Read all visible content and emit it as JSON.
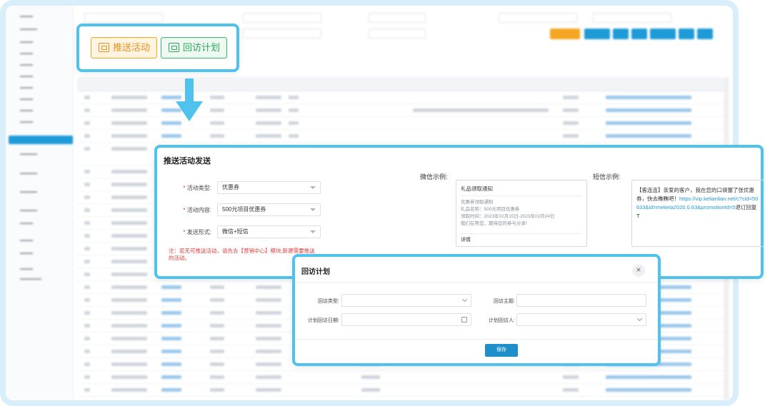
{
  "buttons": {
    "push_activity": "推送活动",
    "visit_plan": "回访计划"
  },
  "push_panel": {
    "title": "推送活动发送",
    "activity_type_label": "活动类型:",
    "activity_type_value": "优惠券",
    "activity_content_label": "活动内容:",
    "activity_content_value": "500元项目优惠券",
    "send_form_label": "发送形式:",
    "send_form_value": "微信+短信",
    "note": "注：若无可推送活动，请先去【营销中心】模块,新建需要推送的活动。",
    "wechat_label": "微信示例:",
    "wechat_card": {
      "title": "礼品领取通知",
      "line1": "优惠券领取通知",
      "line2": "礼品名称：500元项目优惠券",
      "line3": "领取时间：2023年02月15日-2023年02月24日",
      "line4": "我们在等您，期待您的参与分享!",
      "detail": "详情"
    },
    "sms_label": "短信示例:",
    "sms_text": "【客连连】亲爱的客户，我在您的口袋塞了张优惠券，快去瞧瞧吧！",
    "sms_url": "https://vip.kelianlian.net/c?cid=50633&id=mekela2020.0.63&promotionId=5",
    "sms_tail": "退订回复T"
  },
  "visit_dialog": {
    "title": "回访计划",
    "close_icon": "×",
    "visit_type_label": "回访类型:",
    "visit_topic_label": "回访主题:",
    "visit_date_label": "计划回访日期:",
    "visit_person_label": "计划回访人:",
    "save_label": "保存"
  },
  "colors": {
    "highlight": "#4fc3ee",
    "push_orange": "#f5a623",
    "visit_green": "#3bb56b",
    "primary": "#1e8fc9",
    "required": "#e03c3c"
  }
}
